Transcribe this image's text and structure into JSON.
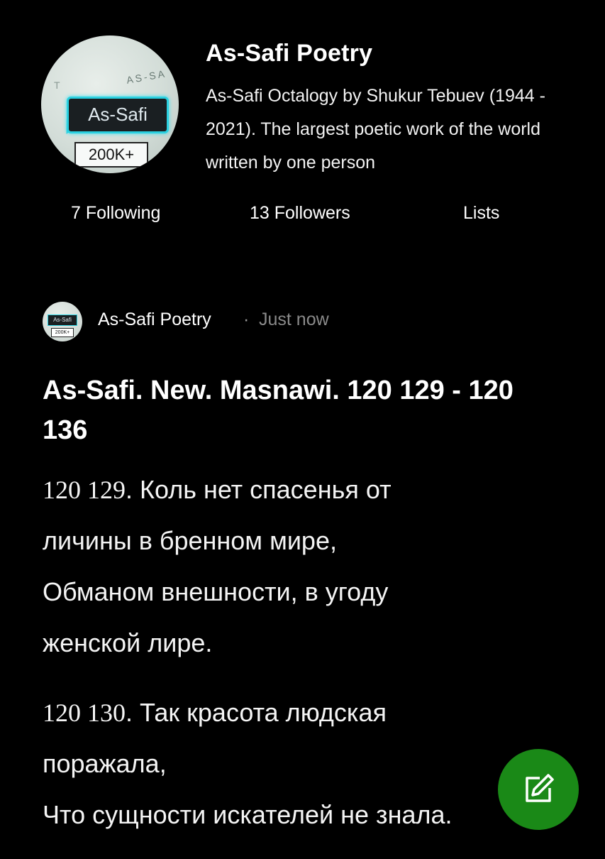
{
  "profile": {
    "name": "As-Safi Poetry",
    "bio": "As-Safi Octalogy by Shukur Tebuev (1944 - 2021). The largest poetic work of the world written by one person",
    "avatar_badge": "As-Safi",
    "avatar_count": "200K+",
    "following": "7 Following",
    "followers": "13 Followers",
    "lists": "Lists"
  },
  "post": {
    "author": "As-Safi Poetry",
    "separator": "·",
    "time": "Just now",
    "avatar_badge": "As-Safi",
    "avatar_count": "200K+",
    "title": "As-Safi. New. Masnawi. 120 129 - 120 136",
    "stanzas": [
      {
        "num": "120 129",
        "line1": ". Коль нет спасенья от",
        "line2": "личины в бренном мире,",
        "line3": "Обманом внешности, в угоду",
        "line4": "женской лире."
      },
      {
        "num": "120 130",
        "line1": ". Так красота людская",
        "line2": "поражала,",
        "line3": "Что сущности искателей не знала."
      }
    ]
  },
  "colors": {
    "background": "#000000",
    "fab": "#1a8917",
    "badge_glow": "#2bd0e0"
  },
  "icons": {
    "fab": "edit-icon"
  }
}
